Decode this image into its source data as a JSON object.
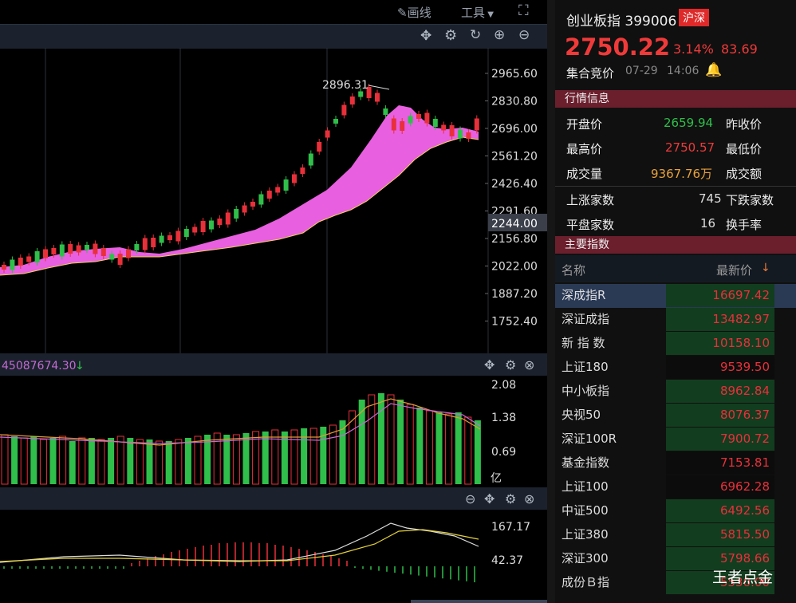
{
  "toolbar": {
    "draw_line": "画线",
    "tools": "工具"
  },
  "main_chart": {
    "price_labels": [
      "2965.60",
      "2830.80",
      "2696.00",
      "2561.20",
      "2426.40",
      "2291.60",
      "2156.80",
      "2022.00",
      "1887.20",
      "1752.40"
    ],
    "current_price_tag": "2244.00",
    "high_marker": "2896.31"
  },
  "volume_panel": {
    "header_value": "45087674.30",
    "header_arrow": "↓",
    "scale_labels": [
      "2.08",
      "1.38",
      "0.69"
    ],
    "unit": "亿"
  },
  "macd_panel": {
    "scale_labels": [
      "167.17",
      "42.37"
    ]
  },
  "quote": {
    "name": "创业板指",
    "code": "399006",
    "market_badge": "沪深",
    "price": "2750.22",
    "change_pct": "3.14%",
    "change": "83.69",
    "status": "集合竞价",
    "date": "07-29",
    "time": "14:06"
  },
  "market_info": {
    "title": "行情信息",
    "open_label": "开盘价",
    "open": "2659.94",
    "prev_close_label": "昨收价",
    "high_label": "最高价",
    "high": "2750.57",
    "low_label": "最低价",
    "volume_label": "成交量",
    "volume": "9367.76万",
    "amount_label": "成交额",
    "up_label": "上涨家数",
    "up": "745",
    "down_label": "下跌家数",
    "flat_label": "平盘家数",
    "flat": "16",
    "turnover_label": "换手率"
  },
  "main_indices": {
    "title": "主要指数",
    "col_name": "名称",
    "col_price": "最新价",
    "rows": [
      {
        "name": "深成指R",
        "price": "16697.42",
        "up": true
      },
      {
        "name": "深证成指",
        "price": "13482.97",
        "up": true
      },
      {
        "name": "新 指 数",
        "price": "10158.10",
        "up": true
      },
      {
        "name": "上证180",
        "price": "9539.50",
        "up": false
      },
      {
        "name": "中小板指",
        "price": "8962.84",
        "up": true
      },
      {
        "name": "央视50",
        "price": "8076.37",
        "up": true
      },
      {
        "name": "深证100R",
        "price": "7900.72",
        "up": true
      },
      {
        "name": "基金指数",
        "price": "7153.81",
        "up": false
      },
      {
        "name": "上证100",
        "price": "6962.28",
        "up": false
      },
      {
        "name": "中证500",
        "price": "6492.56",
        "up": true
      },
      {
        "name": "上证380",
        "price": "5815.50",
        "up": true
      },
      {
        "name": "深证300",
        "price": "5798.66",
        "up": true
      },
      {
        "name": "成份Ｂ指",
        "price": "5530.00",
        "up": true
      }
    ]
  },
  "watermark": "王者点金",
  "colors": {
    "up": "#e8303a",
    "down": "#2fbf4a",
    "ma_fill": "#e85fe0",
    "accent": "#d7323c"
  }
}
